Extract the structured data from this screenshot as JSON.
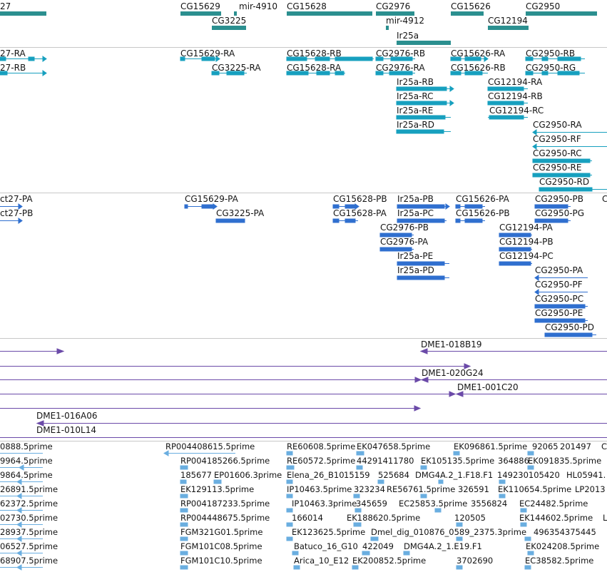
{
  "colors": {
    "gene": "#2b8f8f",
    "transcript": "#17a0bf",
    "protein": "#2f6fcf",
    "clone": "#6b4aa8",
    "est": "#6aaee0",
    "divider": "#c8c8c8"
  },
  "genes": {
    "labels": [
      "27",
      "CG15629",
      "mir-4910",
      "CG15628",
      "CG2976",
      "CG15626",
      "CG2950",
      "CG3225",
      "mir-4912",
      "CG12194",
      "Ir25a"
    ]
  },
  "transcripts": {
    "labels": [
      "27-RA",
      "27-RB",
      "CG15629-RA",
      "CG3225-RA",
      "CG15628-RB",
      "CG15628-RA",
      "CG2976-RB",
      "CG2976-RA",
      "Ir25a-RB",
      "Ir25a-RC",
      "Ir25a-RE",
      "Ir25a-RD",
      "CG15626-RA",
      "CG15626-RB",
      "CG12194-RA",
      "CG12194-RB",
      "CG12194-RC",
      "CG2950-RB",
      "CG2950-RG",
      "CG2950-RA",
      "CG2950-RF",
      "CG2950-RC",
      "CG2950-RE",
      "CG2950-RD"
    ]
  },
  "proteins": {
    "labels": [
      "ct27-PA",
      "ct27-PB",
      "CG15629-PA",
      "CG3225-PA",
      "CG15628-PB",
      "CG15628-PA",
      "Ir25a-PB",
      "Ir25a-PC",
      "CG2976-PB",
      "CG2976-PA",
      "Ir25a-PE",
      "Ir25a-PD",
      "CG15626-PA",
      "CG15626-PB",
      "CG12194-PA",
      "CG12194-PB",
      "CG12194-PC",
      "CG2950-PB",
      "CG2950-PG",
      "CG2950-PA",
      "CG2950-PF",
      "CG2950-PC",
      "CG2950-PE",
      "CG2950-PD",
      "C"
    ]
  },
  "clones": {
    "labels": [
      "DME1-018B19",
      "DME1-020G24",
      "DME1-001C20",
      "DME1-016A06",
      "DME1-010L14"
    ]
  },
  "ests": {
    "labels": [
      "0888.5prime",
      "RP004408615.5prime",
      "RE60608.5prime",
      "EK047658.5prime",
      "EK096861.5prime",
      "92065",
      "201497",
      "C",
      "9964.5prime",
      "RP004185266.5prime",
      "RE60572.5prime",
      "44291411780",
      "EK105135.5prime",
      "364886",
      "EK091835.5prime",
      "9864.5prime",
      "185677",
      "EP01606.3prime",
      "Elena_26_B10",
      "15159",
      "525684",
      "DMG4A.2_1.F18.F1",
      "149230105420",
      "HL05941.",
      "26891.5prime",
      "EK129113.5prime",
      "IP10463.5prime",
      "323234",
      "RE56761.5prime",
      "326591",
      "EK110654.5prime",
      "LP2013",
      "62372.5prime",
      "RP004187233.5prime",
      "IP10463.3prime",
      "345659",
      "EC25853.5prime",
      "3556824",
      "EC24482.5prime",
      "02730.5prime",
      "RP004448675.5prime",
      "166014",
      "EK188620.5prime",
      "120505",
      "EK144602.5prime",
      "L",
      "28937.5prime",
      "FGM321G01.5prime",
      "EK123625.5prime",
      "Dmel_dig_010876_0589_2375.3prime",
      "496354375445",
      "06527.5prime",
      "FGM101C08.5prime",
      "Batuco_16_G10",
      "422049",
      "DMG4A.2_1.E19.F1",
      "EK024208.5prime",
      "68907.5prime",
      "FGM101C10.5prime",
      "Arica_10_E12",
      "EK200852.5prime",
      "3702690",
      "EC38582.5prime"
    ]
  }
}
